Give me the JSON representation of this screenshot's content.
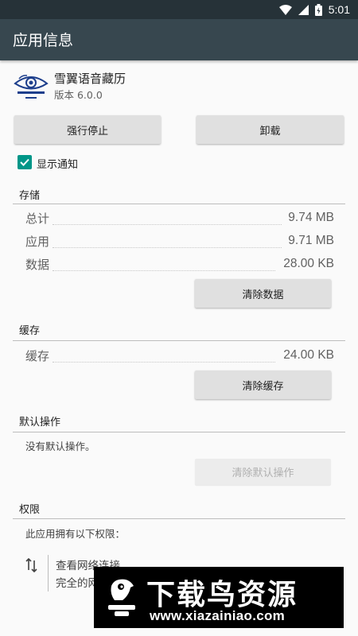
{
  "status_bar": {
    "time": "5:01",
    "colors": {
      "background": "#263238"
    }
  },
  "toolbar": {
    "title": "应用信息",
    "background": "#37474f"
  },
  "app": {
    "name": "雪翼语音藏历",
    "version": "版本 6.0.0",
    "logo_icon": "eye-logo-icon"
  },
  "actions": {
    "force_stop": "强行停止",
    "uninstall": "卸载"
  },
  "notification": {
    "label": "显示通知",
    "checked": true,
    "accent": "#009688"
  },
  "storage": {
    "header": "存储",
    "rows": [
      {
        "label": "总计",
        "value": "9.74 MB"
      },
      {
        "label": "应用",
        "value": "9.71 MB"
      },
      {
        "label": "数据",
        "value": "28.00 KB"
      }
    ],
    "clear_data": "清除数据"
  },
  "cache": {
    "header": "缓存",
    "rows": [
      {
        "label": "缓存",
        "value": "24.00 KB"
      }
    ],
    "clear_cache": "清除缓存"
  },
  "defaults": {
    "header": "默认操作",
    "text": "没有默认操作。",
    "clear_defaults": "清除默认操作"
  },
  "permissions": {
    "header": "权限",
    "intro": "此应用拥有以下权限：",
    "items": [
      {
        "title": "查看网络连接",
        "desc": "完全的网络访问权限",
        "icon": "swap-vertical-icon"
      }
    ]
  },
  "watermark": {
    "title": "下载鸟资源",
    "url": "www.xiazainiao.com"
  }
}
